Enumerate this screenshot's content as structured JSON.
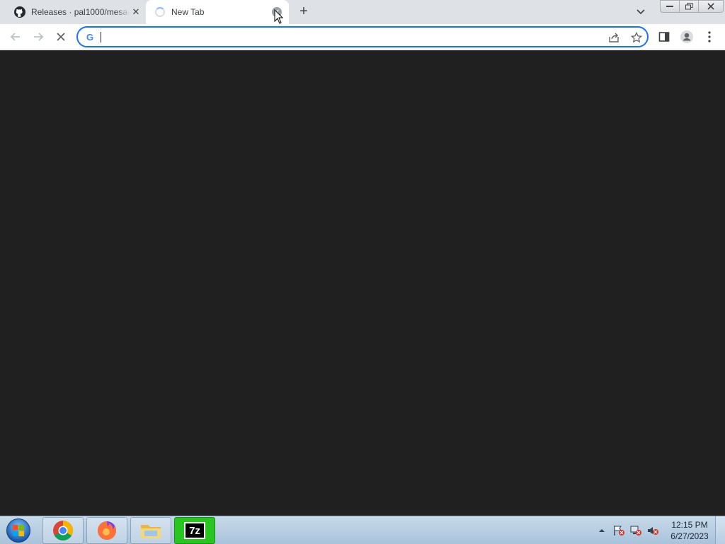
{
  "browser": {
    "tabs": [
      {
        "title": "Releases · pal1000/mesa-",
        "favicon": "github-icon",
        "active": false
      },
      {
        "title": "New Tab",
        "favicon": "loading-spinner",
        "active": true
      }
    ],
    "new_tab_label": "+",
    "omnibox": {
      "value": "",
      "search_engine_icon": "G"
    }
  },
  "taskbar": {
    "apps": [
      "chrome",
      "firefox",
      "file-explorer",
      "7-zip"
    ],
    "seven_zip_label": "7z",
    "clock": {
      "time": "12:15 PM",
      "date": "6/27/2023"
    }
  },
  "colors": {
    "page_background": "#202020",
    "omnibox_focus": "#1a73e8",
    "taskbar": "#b7cde2"
  }
}
